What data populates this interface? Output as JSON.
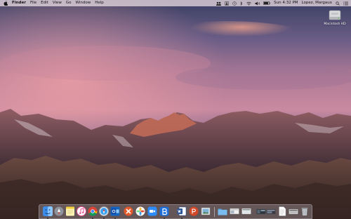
{
  "menubar": {
    "app_name": "Finder",
    "items": [
      "File",
      "Edit",
      "View",
      "Go",
      "Window",
      "Help"
    ],
    "clock": "Sun 4:32 PM",
    "user": "Lopez, Margaux"
  },
  "desktop": {
    "drive_label": "Macintosh HD"
  },
  "dock": {
    "apps": [
      {
        "icon": "finder-icon"
      },
      {
        "icon": "launchpad-icon"
      },
      {
        "icon": "notes-icon"
      },
      {
        "icon": "itunes-icon"
      },
      {
        "icon": "chrome-icon"
      },
      {
        "icon": "safari-icon"
      },
      {
        "icon": "outlook-icon"
      },
      {
        "icon": "xmind-icon"
      },
      {
        "icon": "photos-icon"
      },
      {
        "icon": "zoom-icon"
      },
      {
        "icon": "bluejeans-icon"
      },
      {
        "icon": "word-icon"
      },
      {
        "icon": "powerpoint-icon"
      },
      {
        "icon": "preview-icon"
      }
    ],
    "documents": [
      {
        "icon": "folder-icon"
      },
      {
        "icon": "screenshot-thumbnail-icon"
      },
      {
        "icon": "screenshot-thumbnail-icon"
      },
      {
        "icon": "window-thumbnail-icon"
      },
      {
        "icon": "window-thumbnail-icon"
      },
      {
        "icon": "document-icon"
      },
      {
        "icon": "window-thumbnail-icon"
      },
      {
        "icon": "trash-icon"
      }
    ]
  }
}
